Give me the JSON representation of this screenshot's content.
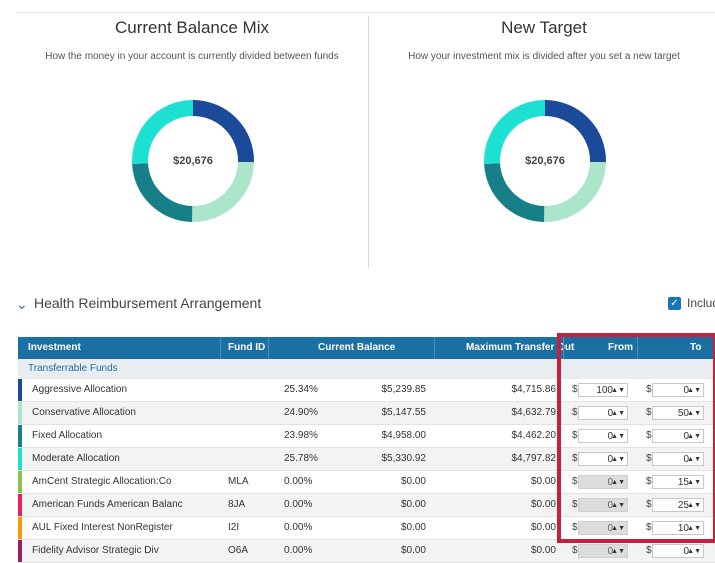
{
  "current_mix": {
    "title": "Current Balance Mix",
    "subtitle": "How the money in your account is currently divided between funds",
    "center_value": "$20,676",
    "segments": [
      {
        "fund": "Aggressive Allocation",
        "percent": 25.34,
        "color": "#1a4a99"
      },
      {
        "fund": "Conservative Allocation",
        "percent": 24.9,
        "color": "#abe5cb"
      },
      {
        "fund": "Fixed Allocation",
        "percent": 23.98,
        "color": "#177f88"
      },
      {
        "fund": "Moderate Allocation",
        "percent": 25.78,
        "color": "#1ce0d2"
      }
    ]
  },
  "new_target": {
    "title": "New Target",
    "subtitle": "How your investment mix is divided after you set a new target",
    "center_value": "$20,676",
    "segments": [
      {
        "fund": "Aggressive Allocation",
        "percent": 25.34,
        "color": "#1a4a99"
      },
      {
        "fund": "Conservative Allocation",
        "percent": 24.9,
        "color": "#abe5cb"
      },
      {
        "fund": "Fixed Allocation",
        "percent": 23.98,
        "color": "#177f88"
      },
      {
        "fund": "Moderate Allocation",
        "percent": 25.78,
        "color": "#1ce0d2"
      }
    ]
  },
  "section": {
    "title": "Health Reimbursement Arrangement",
    "include_label": "Include"
  },
  "table": {
    "headers": {
      "investment": "Investment",
      "fund_id": "Fund ID",
      "current_balance": "Current Balance",
      "max_transfer": "Maximum Transfer Out",
      "from": "From",
      "to": "To"
    },
    "group_label": "Transferrable Funds",
    "currency_symbol": "$",
    "rows": [
      {
        "name": "Aggressive Allocation",
        "fund_id": "",
        "percent": "25.34%",
        "balance": "$5,239.85",
        "max_out": "$4,715.86",
        "from": "100",
        "to": "0",
        "from_disabled": false,
        "color": "#1a4a99"
      },
      {
        "name": "Conservative Allocation",
        "fund_id": "",
        "percent": "24.90%",
        "balance": "$5,147.55",
        "max_out": "$4,632.79",
        "from": "0",
        "to": "50",
        "from_disabled": false,
        "color": "#abe5cb"
      },
      {
        "name": "Fixed Allocation",
        "fund_id": "",
        "percent": "23.98%",
        "balance": "$4,958.00",
        "max_out": "$4,462.20",
        "from": "0",
        "to": "0",
        "from_disabled": false,
        "color": "#177f88"
      },
      {
        "name": "Moderate Allocation",
        "fund_id": "",
        "percent": "25.78%",
        "balance": "$5,330.92",
        "max_out": "$4,797.82",
        "from": "0",
        "to": "0",
        "from_disabled": false,
        "color": "#1ce0d2"
      },
      {
        "name": "AmCent Strategic Allocation:Co",
        "fund_id": "MLA",
        "percent": "0.00%",
        "balance": "$0.00",
        "max_out": "$0.00",
        "from": "0",
        "to": "15",
        "from_disabled": true,
        "color": "#8bc34a"
      },
      {
        "name": "American Funds American Balanc",
        "fund_id": "8JA",
        "percent": "0.00%",
        "balance": "$0.00",
        "max_out": "$0.00",
        "from": "0",
        "to": "25",
        "from_disabled": true,
        "color": "#e91e63"
      },
      {
        "name": "AUL Fixed Interest NonRegister",
        "fund_id": "I2I",
        "percent": "0.00%",
        "balance": "$0.00",
        "max_out": "$0.00",
        "from": "0",
        "to": "10",
        "from_disabled": true,
        "color": "#ff9800"
      },
      {
        "name": "Fidelity Advisor Strategic Div",
        "fund_id": "O6A",
        "percent": "0.00%",
        "balance": "$0.00",
        "max_out": "$0.00",
        "from": "0",
        "to": "0",
        "from_disabled": true,
        "color": "#9c1c6b"
      }
    ]
  }
}
